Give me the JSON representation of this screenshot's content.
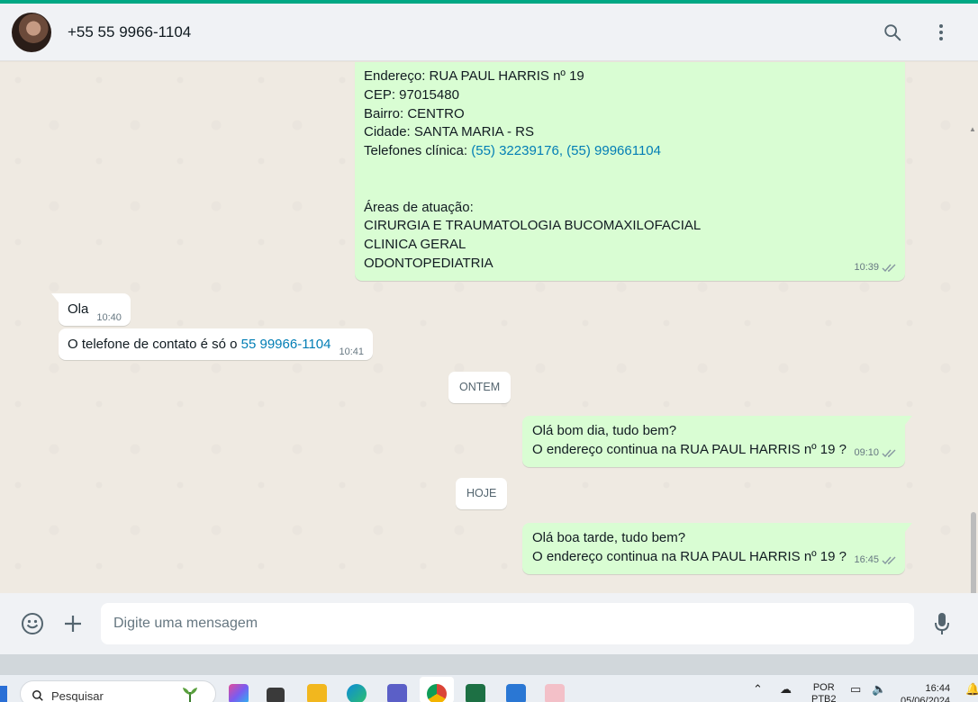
{
  "header": {
    "contact_name": "+55 55 9966-1104",
    "icons": [
      "avatar",
      "search-icon",
      "menu-dots-icon"
    ]
  },
  "messages": {
    "m1": {
      "direction": "outgoing",
      "lines": [
        "Endereço: RUA PAUL HARRIS nº 19",
        "CEP: 97015480",
        "Bairro: CENTRO",
        "Cidade: SANTA MARIA - RS"
      ],
      "phones_label": "Telefones clínica: ",
      "phone_1": "(55) 32239176",
      "phone_sep": ", ",
      "phone_2": "(55) 999661104",
      "areas_title": "Áreas de atuação:",
      "areas": [
        "CIRURGIA E TRAUMATOLOGIA BUCOMAXILOFACIAL",
        "CLINICA GERAL",
        "ODONTOPEDIATRIA"
      ],
      "time": "10:39"
    },
    "m2": {
      "direction": "incoming",
      "text": "Ola",
      "time": "10:40"
    },
    "m3": {
      "direction": "incoming",
      "text": "O telefone de contato é só o ",
      "link": "55 99966-1104",
      "time": "10:41"
    },
    "date_1": "ONTEM",
    "m4": {
      "direction": "outgoing",
      "line1": "Olá bom dia, tudo bem?",
      "line2": "O endereço continua na RUA PAUL HARRIS nº 19 ?",
      "time": "09:10"
    },
    "date_2": "HOJE",
    "m5": {
      "direction": "outgoing",
      "line1": "Olá boa tarde, tudo bem?",
      "line2": "O endereço continua na RUA PAUL HARRIS nº 19 ?",
      "time": "16:45"
    }
  },
  "composer": {
    "placeholder": "Digite uma mensagem",
    "icons": [
      "emoji-icon",
      "plus-icon",
      "mic-icon"
    ]
  },
  "taskbar": {
    "search_label": "Pesquisar",
    "lang_line1": "POR",
    "lang_line2": "PTB2",
    "time": "16:44",
    "date": "05/06/2024"
  },
  "colors": {
    "accent": "#00a884",
    "outgoing_bubble": "#d9fdd3",
    "incoming_bubble": "#ffffff",
    "link": "#027eb5",
    "chat_bg": "#efeae2"
  }
}
